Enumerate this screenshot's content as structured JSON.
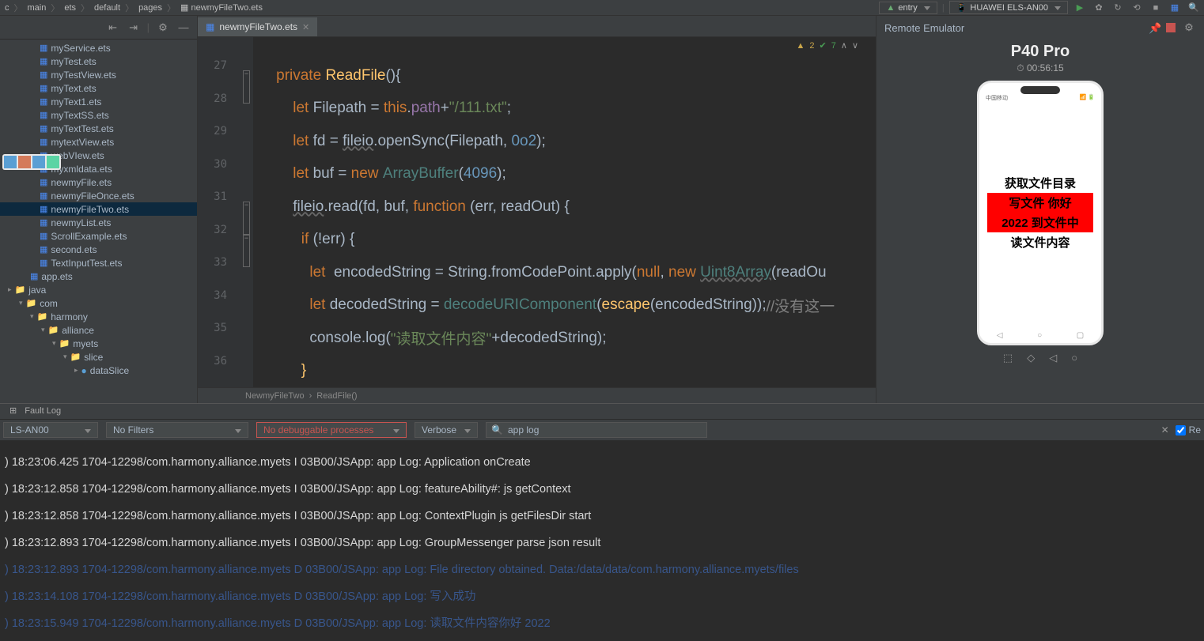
{
  "breadcrumb": [
    "c",
    "main",
    "ets",
    "default",
    "pages",
    "newmyFileTwo.ets"
  ],
  "topRight": {
    "entry": "entry",
    "device": "HUAWEI ELS-AN00"
  },
  "sidebar": {
    "files": [
      {
        "name": "myService.ets",
        "lvl": 0
      },
      {
        "name": "myTest.ets",
        "lvl": 0
      },
      {
        "name": "myTestView.ets",
        "lvl": 0
      },
      {
        "name": "myText.ets",
        "lvl": 0
      },
      {
        "name": "myText1.ets",
        "lvl": 0
      },
      {
        "name": "myTextSS.ets",
        "lvl": 0
      },
      {
        "name": "myTextTest.ets",
        "lvl": 0
      },
      {
        "name": "mytextView.ets",
        "lvl": 0
      },
      {
        "name": "webVIew.ets",
        "lvl": 0
      },
      {
        "name": "myxmldata.ets",
        "lvl": 0
      },
      {
        "name": "newmyFile.ets",
        "lvl": 0
      },
      {
        "name": "newmyFileOnce.ets",
        "lvl": 0
      },
      {
        "name": "newmyFileTwo.ets",
        "lvl": 0,
        "selected": true
      },
      {
        "name": "newmyList.ets",
        "lvl": 0
      },
      {
        "name": "ScrollExample.ets",
        "lvl": 0
      },
      {
        "name": "second.ets",
        "lvl": 0
      },
      {
        "name": "TextInputTest.ets",
        "lvl": 0
      },
      {
        "name": "app.ets",
        "lvl": -1
      }
    ],
    "folders": [
      {
        "name": "java",
        "lvl": 0,
        "open": false
      },
      {
        "name": "com",
        "lvl": 1,
        "open": true
      },
      {
        "name": "harmony",
        "lvl": 2,
        "open": true
      },
      {
        "name": "alliance",
        "lvl": 3,
        "open": true
      },
      {
        "name": "myets",
        "lvl": 4,
        "open": true
      },
      {
        "name": "slice",
        "lvl": 5,
        "open": true
      },
      {
        "name": "dataSlice",
        "lvl": 6,
        "open": false,
        "leaf": true
      }
    ]
  },
  "tab": {
    "name": "newmyFileTwo.ets"
  },
  "inspection": {
    "warn": "2",
    "ok": "7"
  },
  "code": {
    "startLine": 27,
    "lines": [
      [
        {
          "t": "    ",
          "c": ""
        },
        {
          "t": "private",
          "c": "kw"
        },
        {
          "t": " ",
          "c": ""
        },
        {
          "t": "ReadFile",
          "c": "func"
        },
        {
          "t": "(){",
          "c": ""
        }
      ],
      [
        {
          "t": "        ",
          "c": ""
        },
        {
          "t": "let",
          "c": "kw"
        },
        {
          "t": " Filepath = ",
          "c": ""
        },
        {
          "t": "this",
          "c": "kw"
        },
        {
          "t": ".",
          "c": ""
        },
        {
          "t": "path",
          "c": "ident"
        },
        {
          "t": "+",
          "c": ""
        },
        {
          "t": "\"/111.txt\"",
          "c": "str"
        },
        {
          "t": ";",
          "c": ""
        }
      ],
      [
        {
          "t": "        ",
          "c": ""
        },
        {
          "t": "let",
          "c": "kw"
        },
        {
          "t": " fd = ",
          "c": ""
        },
        {
          "t": "fileio",
          "c": "underline"
        },
        {
          "t": ".openSync(Filepath, ",
          "c": ""
        },
        {
          "t": "0o2",
          "c": "num"
        },
        {
          "t": ");",
          "c": ""
        }
      ],
      [
        {
          "t": "        ",
          "c": ""
        },
        {
          "t": "let",
          "c": "kw"
        },
        {
          "t": " buf = ",
          "c": ""
        },
        {
          "t": "new",
          "c": "kw"
        },
        {
          "t": " ",
          "c": ""
        },
        {
          "t": "ArrayBuffer",
          "c": "type"
        },
        {
          "t": "(",
          "c": ""
        },
        {
          "t": "4096",
          "c": "num"
        },
        {
          "t": ");",
          "c": ""
        }
      ],
      [
        {
          "t": "        ",
          "c": ""
        },
        {
          "t": "fileio",
          "c": "underline"
        },
        {
          "t": ".read(fd, buf, ",
          "c": ""
        },
        {
          "t": "function",
          "c": "kw"
        },
        {
          "t": " (err, readOut) {",
          "c": ""
        }
      ],
      [
        {
          "t": "          ",
          "c": ""
        },
        {
          "t": "if",
          "c": "kw"
        },
        {
          "t": " (!err) {",
          "c": ""
        }
      ],
      [
        {
          "t": "            ",
          "c": ""
        },
        {
          "t": "let",
          "c": "kw"
        },
        {
          "t": "  encodedString = String.fromCodePoint.apply(",
          "c": ""
        },
        {
          "t": "null",
          "c": "kw"
        },
        {
          "t": ", ",
          "c": ""
        },
        {
          "t": "new",
          "c": "kw"
        },
        {
          "t": " ",
          "c": ""
        },
        {
          "t": "Uint8Array",
          "c": "type underline"
        },
        {
          "t": "(readOu",
          "c": ""
        }
      ],
      [
        {
          "t": "            ",
          "c": ""
        },
        {
          "t": "let",
          "c": "kw"
        },
        {
          "t": " decodedString = ",
          "c": ""
        },
        {
          "t": "decodeURIComponent",
          "c": "type"
        },
        {
          "t": "(",
          "c": ""
        },
        {
          "t": "escape",
          "c": "func"
        },
        {
          "t": "(encodedString));",
          "c": ""
        },
        {
          "t": "//没有这一",
          "c": "comment"
        }
      ],
      [
        {
          "t": "            console.log(",
          "c": ""
        },
        {
          "t": "\"读取文件内容\"",
          "c": "str"
        },
        {
          "t": "+decodedString);",
          "c": ""
        }
      ],
      [
        {
          "t": "          }",
          "c": "func"
        }
      ]
    ]
  },
  "breadcrumbBottom": [
    "NewmyFileTwo",
    "ReadFile()"
  ],
  "emulator": {
    "header": "Remote Emulator",
    "title": "P40 Pro",
    "time": "00:56:15",
    "screen": {
      "line1": "获取文件目录",
      "line2": "写文件 你好",
      "line3": "2022 到文件中",
      "line4": "读文件内容"
    }
  },
  "bottomTab": "Fault Log",
  "filter": {
    "device": "LS-AN00",
    "filters": "No Filters",
    "process": "No debuggable processes",
    "level": "Verbose",
    "search": "app log",
    "regex": "Re"
  },
  "log": [
    {
      "level": "info",
      "text": ") 18:23:06.425 1704-12298/com.harmony.alliance.myets I 03B00/JSApp:  app Log: Application onCreate"
    },
    {
      "level": "info",
      "text": ") 18:23:12.858 1704-12298/com.harmony.alliance.myets I 03B00/JSApp:  app Log: featureAbility#: js getContext"
    },
    {
      "level": "info",
      "text": ") 18:23:12.858 1704-12298/com.harmony.alliance.myets I 03B00/JSApp:  app Log: ContextPlugin js getFilesDir start"
    },
    {
      "level": "info",
      "text": ") 18:23:12.893 1704-12298/com.harmony.alliance.myets I 03B00/JSApp:  app Log: GroupMessenger parse json result"
    },
    {
      "level": "debug",
      "text": ") 18:23:12.893 1704-12298/com.harmony.alliance.myets D 03B00/JSApp:  app Log: File directory obtained. Data:/data/data/com.harmony.alliance.myets/files"
    },
    {
      "level": "debug",
      "text": ") 18:23:14.108 1704-12298/com.harmony.alliance.myets D 03B00/JSApp:  app Log: 写入成功"
    },
    {
      "level": "debug",
      "text": ") 18:23:15.949 1704-12298/com.harmony.alliance.myets D 03B00/JSApp:  app Log: 读取文件内容你好 2022"
    }
  ]
}
